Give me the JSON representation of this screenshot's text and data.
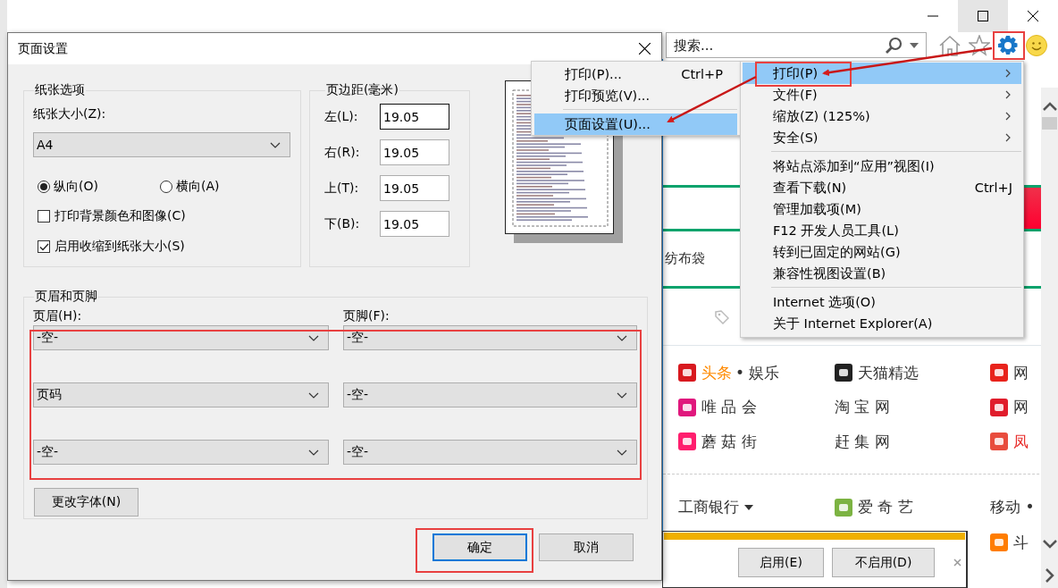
{
  "browser": {
    "search": {
      "placeholder": "搜索..."
    }
  },
  "web_page": {
    "strip_texts": [
      "纺布袋"
    ],
    "link_columns": [
      [
        {
          "label": "头条",
          "color": "#ff8a00",
          "suffix": "• 娱乐",
          "icon": true
        },
        {
          "label": "唯 品 会",
          "icon": true
        },
        {
          "label": "蘑 菇 街",
          "icon": true
        },
        {
          "label": "工商银行",
          "dropdown": true
        }
      ],
      [
        {
          "label": "天猫精选",
          "icon": true
        },
        {
          "label": "淘 宝 网"
        },
        {
          "label": "赶 集 网"
        },
        {
          "label": "爱 奇 艺",
          "icon": true
        }
      ],
      [
        {
          "label": "网",
          "icon": true
        },
        {
          "label": "网",
          "icon": true
        },
        {
          "label": "凤",
          "color": "#e8302e",
          "icon": true
        },
        {
          "label": "移动 •"
        },
        {
          "label": "斗",
          "icon": true
        }
      ]
    ]
  },
  "notification": {
    "buttons": [
      "启用(E)",
      "不启用(D)"
    ]
  },
  "dialog": {
    "title": "页面设置",
    "paper": {
      "legend": "纸张选项",
      "size_label": "纸张大小(Z):",
      "size_value": "A4",
      "orientations": [
        {
          "label": "纵向(O)",
          "selected": true
        },
        {
          "label": "横向(A)",
          "selected": false
        }
      ],
      "checkboxes": [
        {
          "label": "打印背景颜色和图像(C)",
          "checked": false
        },
        {
          "label": "启用收缩到纸张大小(S)",
          "checked": true
        }
      ]
    },
    "margins": {
      "legend": "页边距(毫米)",
      "fields": [
        {
          "label": "左(L):",
          "value": "19.05",
          "focused": true
        },
        {
          "label": "右(R):",
          "value": "19.05",
          "focused": false
        },
        {
          "label": "上(T):",
          "value": "19.05",
          "focused": false
        },
        {
          "label": "下(B):",
          "value": "19.05",
          "focused": false
        }
      ]
    },
    "header_footer": {
      "legend": "页眉和页脚",
      "header_label": "页眉(H):",
      "footer_label": "页脚(F):",
      "header": [
        "-空-",
        "页码",
        "-空-"
      ],
      "footer": [
        "-空-",
        "-空-",
        "-空-"
      ],
      "font_button": "更改字体(N)"
    },
    "buttons": [
      {
        "label": "确定",
        "default": true
      },
      {
        "label": "取消",
        "default": false
      }
    ]
  },
  "print_submenu": {
    "items": [
      {
        "label": "打印(P)...",
        "shortcut": "Ctrl+P",
        "selected": false
      },
      {
        "label": "打印预览(V)...",
        "selected": false
      },
      {
        "label": "页面设置(U)...",
        "selected": true,
        "separator_before": true
      }
    ]
  },
  "tools_menu": {
    "items": [
      {
        "label": "打印(P)",
        "submenu": true,
        "selected": true
      },
      {
        "label": "文件(F)",
        "submenu": true,
        "selected": false
      },
      {
        "label": "缩放(Z) (125%)",
        "submenu": true,
        "selected": false
      },
      {
        "label": "安全(S)",
        "submenu": true,
        "selected": false
      },
      {
        "label": "将站点添加到“应用”视图(I)",
        "selected": false,
        "separator_before": true
      },
      {
        "label": "查看下载(N)",
        "shortcut": "Ctrl+J",
        "selected": false
      },
      {
        "label": "管理加载项(M)",
        "selected": false
      },
      {
        "label": "F12 开发人员工具(L)",
        "selected": false
      },
      {
        "label": "转到已固定的网站(G)",
        "selected": false
      },
      {
        "label": "兼容性视图设置(B)",
        "selected": false
      },
      {
        "label": "Internet 选项(O)",
        "selected": false,
        "separator_before": true
      },
      {
        "label": "关于 Internet Explorer(A)",
        "selected": false
      }
    ]
  }
}
